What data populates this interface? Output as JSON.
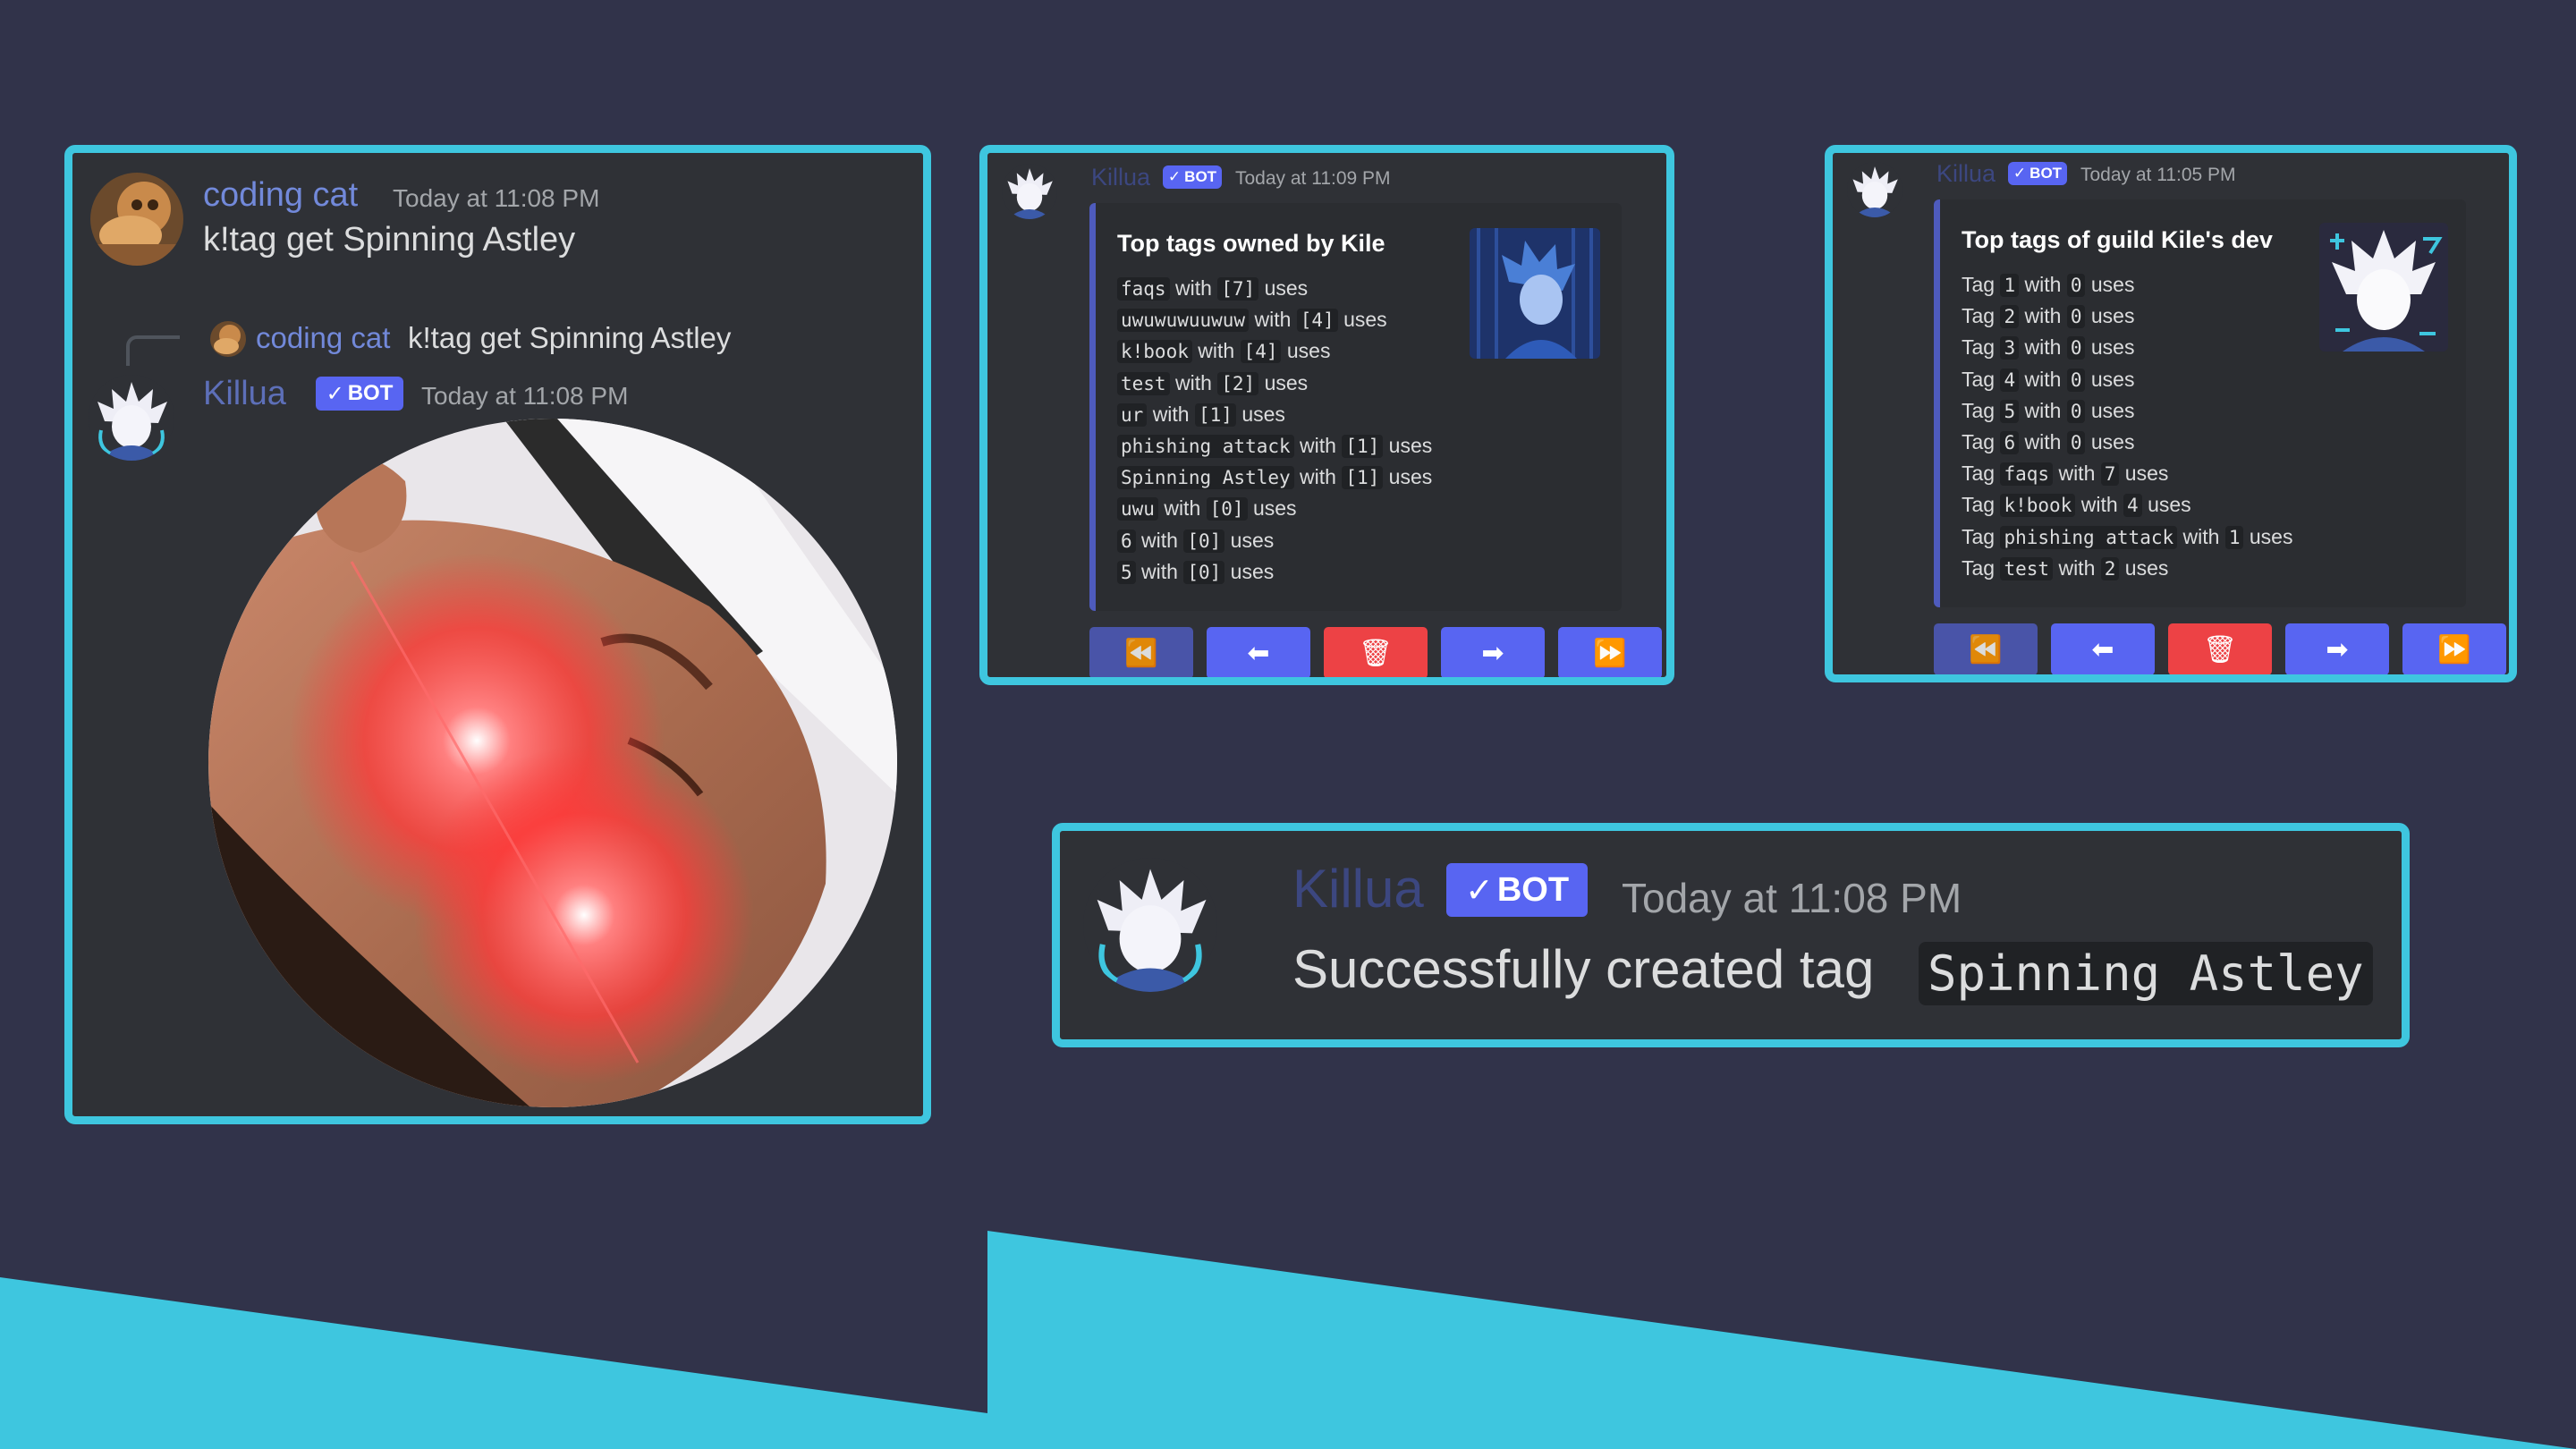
{
  "colors": {
    "background": "#31334a",
    "accent_cyan": "#3ec6df",
    "card_bg": "#2f3136",
    "blurple": "#5865f2",
    "danger": "#ed4245",
    "username": "#7289da"
  },
  "card1": {
    "user_message": {
      "username": "coding cat",
      "timestamp": "Today at 11:08 PM",
      "text": "k!tag get Spinning Astley"
    },
    "reply_reference": {
      "username": "coding cat",
      "text": "k!tag get Spinning Astley"
    },
    "bot_message": {
      "username": "Killua",
      "badge": "BOT",
      "timestamp": "Today at 11:08 PM",
      "image_icon": "spinning-face-image"
    }
  },
  "card2": {
    "username": "Killua",
    "badge": "BOT",
    "timestamp": "Today at 11:09 PM",
    "embed": {
      "title": "Top tags owned by Kile",
      "rows": [
        {
          "name": "faqs",
          "count": "[7]"
        },
        {
          "name": "uwuwuwuuwuw",
          "count": "[4]"
        },
        {
          "name": "k!book",
          "count": "[4]"
        },
        {
          "name": "test",
          "count": "[2]"
        },
        {
          "name": "ur",
          "count": "[1]"
        },
        {
          "name": "phishing attack",
          "count": "[1]"
        },
        {
          "name": "Spinning Astley",
          "count": "[1]"
        },
        {
          "name": "uwu",
          "count": "[0]"
        },
        {
          "name": "6",
          "count": "[0]"
        },
        {
          "name": "5",
          "count": "[0]"
        }
      ],
      "with_word": "with",
      "uses_word": "uses"
    },
    "buttons": [
      "first-page-icon",
      "previous-page-icon",
      "delete-icon",
      "next-page-icon",
      "last-page-icon"
    ]
  },
  "card3": {
    "username": "Killua",
    "badge": "BOT",
    "timestamp": "Today at 11:05 PM",
    "embed": {
      "title": "Top tags of guild Kile's dev",
      "tag_word": "Tag",
      "with_word": "with",
      "uses_word": "uses",
      "rows": [
        {
          "name": "1",
          "count": "0"
        },
        {
          "name": "2",
          "count": "0"
        },
        {
          "name": "3",
          "count": "0"
        },
        {
          "name": "4",
          "count": "0"
        },
        {
          "name": "5",
          "count": "0"
        },
        {
          "name": "6",
          "count": "0"
        },
        {
          "name": "faqs",
          "count": "7"
        },
        {
          "name": "k!book",
          "count": "4"
        },
        {
          "name": "phishing attack",
          "count": "1"
        },
        {
          "name": "test",
          "count": "2"
        }
      ]
    },
    "buttons": [
      "first-page-icon",
      "previous-page-icon",
      "delete-icon",
      "next-page-icon",
      "last-page-icon"
    ]
  },
  "card4": {
    "username": "Killua",
    "badge": "BOT",
    "timestamp": "Today at 11:08 PM",
    "message_prefix": "Successfully created tag",
    "tag_name": "Spinning Astley"
  }
}
